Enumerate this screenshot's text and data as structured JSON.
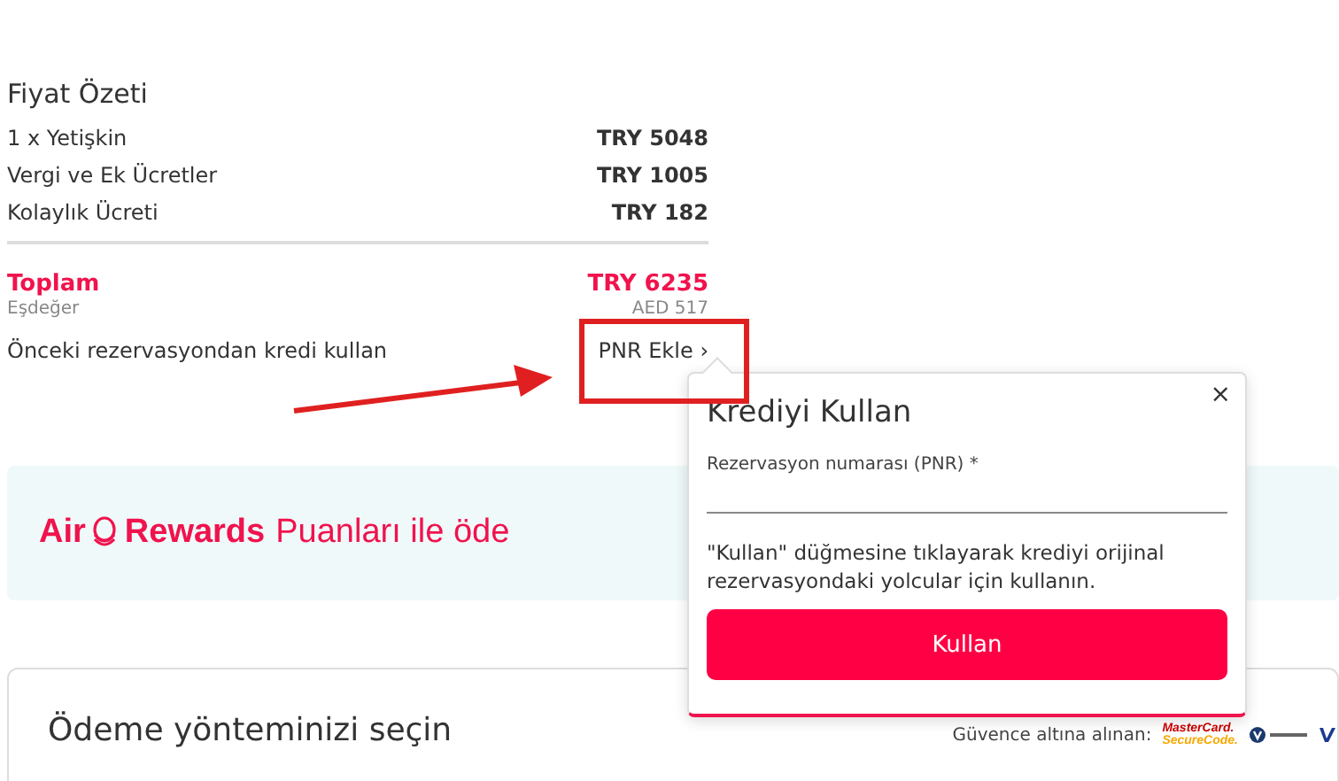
{
  "summary": {
    "title": "Fiyat Özeti",
    "lines": [
      {
        "label": "1 x Yetişkin",
        "amount": "TRY 5048"
      },
      {
        "label": "Vergi ve Ek Ücretler",
        "amount": "TRY 1005"
      },
      {
        "label": "Kolaylık Ücreti",
        "amount": "TRY 182"
      }
    ],
    "total": {
      "label": "Toplam",
      "amount": "TRY 6235"
    },
    "equivalent": {
      "label": "Eşdeğer",
      "amount": "AED 517"
    },
    "credit": {
      "label": "Önceki rezervasyondan kredi kullan",
      "link": "PNR Ekle",
      "chevron": "›"
    }
  },
  "rewards": {
    "brand_air": "Air",
    "brand_rewards": "Rewards",
    "text": "Puanları ile öde"
  },
  "payment": {
    "title": "Ödeme yönteminizi seçin",
    "secured_label": "Güvence altına alınan:",
    "logo_line1": "MasterCard.",
    "logo_line2": "SecureCode."
  },
  "popup": {
    "close": "×",
    "title": "Krediyi Kullan",
    "field_label": "Rezervasyon numarası (PNR) *",
    "note": "\"Kullan\" düğmesine tıklayarak krediyi orijinal rezervasyondaki yolcular için kullanın.",
    "button": "Kullan"
  }
}
